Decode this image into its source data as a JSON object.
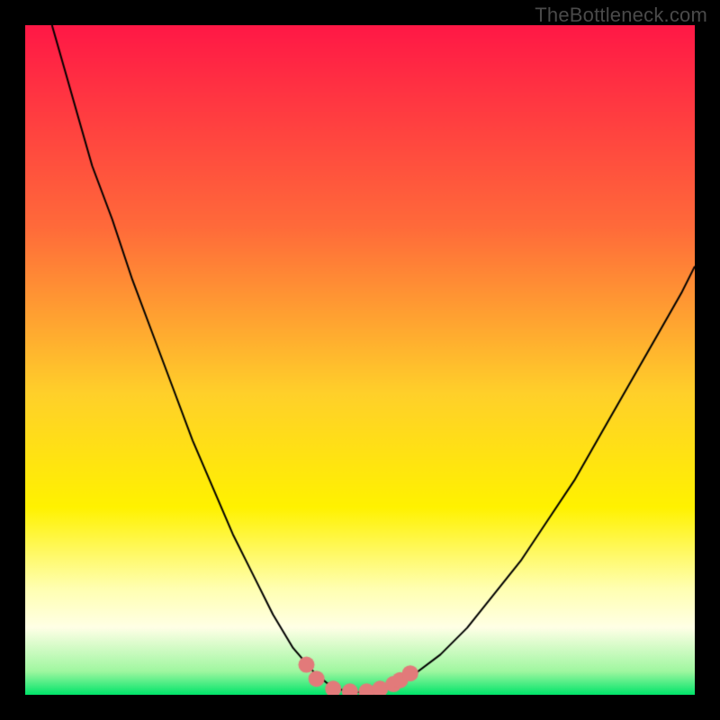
{
  "watermark": "TheBottleneck.com",
  "chart_data": {
    "type": "line",
    "title": "",
    "xlabel": "",
    "ylabel": "",
    "xlim": [
      0,
      100
    ],
    "ylim": [
      0,
      100
    ],
    "grid": false,
    "legend": false,
    "background_gradient": {
      "stops": [
        {
          "pos": 0.0,
          "color": "#ff1846"
        },
        {
          "pos": 0.3,
          "color": "#ff6a3a"
        },
        {
          "pos": 0.55,
          "color": "#ffd02a"
        },
        {
          "pos": 0.72,
          "color": "#fff200"
        },
        {
          "pos": 0.84,
          "color": "#ffffb0"
        },
        {
          "pos": 0.9,
          "color": "#ffffe6"
        },
        {
          "pos": 0.965,
          "color": "#9ff7a0"
        },
        {
          "pos": 1.0,
          "color": "#00e46a"
        }
      ]
    },
    "series": [
      {
        "name": "bottleneck-curve",
        "color": "#000000",
        "width": 2,
        "x": [
          4,
          6,
          8,
          10,
          13,
          16,
          19,
          22,
          25,
          28,
          31,
          34,
          37,
          40,
          43,
          45,
          47,
          49,
          51,
          53,
          55,
          58,
          62,
          66,
          70,
          74,
          78,
          82,
          86,
          90,
          94,
          98,
          100
        ],
        "y": [
          100,
          93,
          86,
          79,
          71,
          62,
          54,
          46,
          38,
          31,
          24,
          18,
          12,
          7,
          3.5,
          1.8,
          0.8,
          0.4,
          0.4,
          0.8,
          1.5,
          3,
          6,
          10,
          15,
          20,
          26,
          32,
          39,
          46,
          53,
          60,
          64
        ]
      }
    ],
    "markers": {
      "color": "#e27a7a",
      "radius_px": 9,
      "points": [
        {
          "x": 42,
          "y": 4.5
        },
        {
          "x": 43.5,
          "y": 2.4
        },
        {
          "x": 46,
          "y": 0.9
        },
        {
          "x": 48.5,
          "y": 0.5
        },
        {
          "x": 51,
          "y": 0.5
        },
        {
          "x": 53,
          "y": 0.9
        },
        {
          "x": 55,
          "y": 1.6
        },
        {
          "x": 56,
          "y": 2.2
        },
        {
          "x": 57.5,
          "y": 3.2
        }
      ]
    }
  }
}
